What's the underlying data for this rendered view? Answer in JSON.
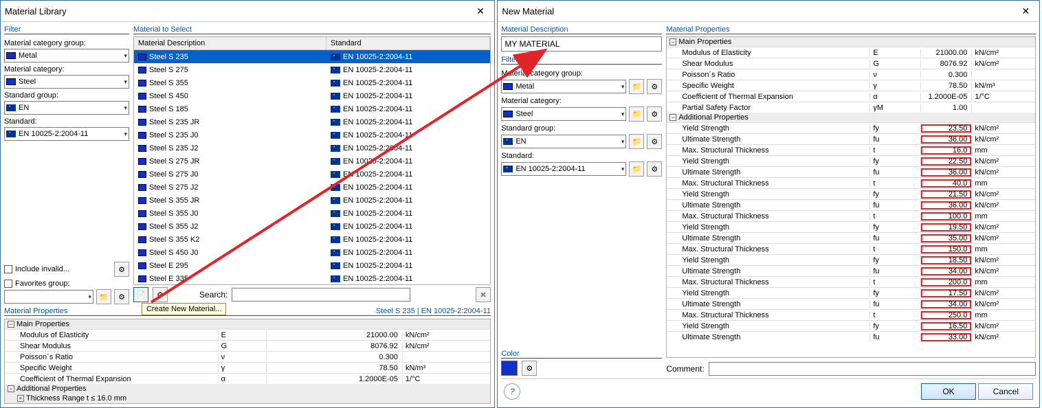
{
  "dlg1": {
    "title": "Material Library",
    "sections": {
      "filter": "Filter",
      "select": "Material to Select",
      "props": "Material Properties"
    },
    "filters": {
      "catgrp_lbl": "Material category group:",
      "catgrp_val": "Metal",
      "cat_lbl": "Material category:",
      "cat_val": "Steel",
      "stdgrp_lbl": "Standard group:",
      "stdgrp_val": "EN",
      "std_lbl": "Standard:",
      "std_val": "EN 10025-2:2004-11",
      "invalid": "Include invalid...",
      "fav": "Favorites group:"
    },
    "listhead": {
      "c1": "Material Description",
      "c2": "Standard"
    },
    "materials": [
      {
        "d": "Steel S 235",
        "s": "EN 10025-2:2004-11",
        "sel": true
      },
      {
        "d": "Steel S 275",
        "s": "EN 10025-2:2004-11"
      },
      {
        "d": "Steel S 355",
        "s": "EN 10025-2:2004-11"
      },
      {
        "d": "Steel S 450",
        "s": "EN 10025-2:2004-11"
      },
      {
        "d": "Steel S 185",
        "s": "EN 10025-2:2004-11"
      },
      {
        "d": "Steel S 235 JR",
        "s": "EN 10025-2:2004-11"
      },
      {
        "d": "Steel S 235 J0",
        "s": "EN 10025-2:2004-11"
      },
      {
        "d": "Steel S 235 J2",
        "s": "EN 10025-2:2004-11"
      },
      {
        "d": "Steel S 275 JR",
        "s": "EN 10025-2:2004-11"
      },
      {
        "d": "Steel S 275 J0",
        "s": "EN 10025-2:2004-11"
      },
      {
        "d": "Steel S 275 J2",
        "s": "EN 10025-2:2004-11"
      },
      {
        "d": "Steel S 355 JR",
        "s": "EN 10025-2:2004-11"
      },
      {
        "d": "Steel S 355 J0",
        "s": "EN 10025-2:2004-11"
      },
      {
        "d": "Steel S 355 J2",
        "s": "EN 10025-2:2004-11"
      },
      {
        "d": "Steel S 355 K2",
        "s": "EN 10025-2:2004-11"
      },
      {
        "d": "Steel S 450 J0",
        "s": "EN 10025-2:2004-11"
      },
      {
        "d": "Steel E 295",
        "s": "EN 10025-2:2004-11"
      },
      {
        "d": "Steel E 335",
        "s": "EN 10025-2:2004-11"
      }
    ],
    "search_lbl": "Search:",
    "tooltip": "Create New Material...",
    "selinfo": "Steel S 235  |  EN 10025-2:2004-11",
    "main_lbl": "Main Properties",
    "addl_lbl": "Additional Properties",
    "thick_lbl": "Thickness Range t ≤ 16.0 mm",
    "props": [
      {
        "n": "Modulus of Elasticity",
        "s": "E",
        "v": "21000.00",
        "u": "kN/cm²"
      },
      {
        "n": "Shear Modulus",
        "s": "G",
        "v": "8076.92",
        "u": "kN/cm²"
      },
      {
        "n": "Poisson´s Ratio",
        "s": "ν",
        "v": "0.300",
        "u": ""
      },
      {
        "n": "Specific Weight",
        "s": "γ",
        "v": "78.50",
        "u": "kN/m³"
      },
      {
        "n": "Coefficient of Thermal Expansion",
        "s": "α",
        "v": "1.2000E-05",
        "u": "1/°C"
      }
    ]
  },
  "dlg2": {
    "title": "New Material",
    "sections": {
      "desc": "Material Description",
      "filter": "Filter",
      "props": "Material Properties",
      "color": "Color"
    },
    "desc_val": "MY MATERIAL",
    "filters": {
      "catgrp_lbl": "Material category group:",
      "catgrp_val": "Metal",
      "cat_lbl": "Material category:",
      "cat_val": "Steel",
      "stdgrp_lbl": "Standard group:",
      "stdgrp_val": "EN",
      "std_lbl": "Standard:",
      "std_val": "EN 10025-2:2004-11"
    },
    "main_lbl": "Main Properties",
    "addl_lbl": "Additional Properties",
    "main": [
      {
        "n": "Modulus of Elasticity",
        "s": "E",
        "v": "21000.00",
        "u": "kN/cm²"
      },
      {
        "n": "Shear Modulus",
        "s": "G",
        "v": "8076.92",
        "u": "kN/cm²"
      },
      {
        "n": "Poisson´s Ratio",
        "s": "ν",
        "v": "0.300",
        "u": ""
      },
      {
        "n": "Specific Weight",
        "s": "γ",
        "v": "78.50",
        "u": "kN/m³"
      },
      {
        "n": "Coefficient of Thermal Expansion",
        "s": "α",
        "v": "1.2000E-05",
        "u": "1/°C"
      },
      {
        "n": "Partial Safety Factor",
        "s": "γM",
        "v": "1.00",
        "u": ""
      }
    ],
    "addl": [
      {
        "n": "Yield Strength",
        "s": "fy",
        "v": "23.50",
        "u": "kN/cm²",
        "hl": true
      },
      {
        "n": "Ultimate Strength",
        "s": "fu",
        "v": "36.00",
        "u": "kN/cm²",
        "hl": true
      },
      {
        "n": "Max. Structural Thickness",
        "s": "t",
        "v": "16.0",
        "u": "mm",
        "hl": true
      },
      {
        "n": "Yield Strength",
        "s": "fy",
        "v": "22.50",
        "u": "kN/cm²",
        "hl": true
      },
      {
        "n": "Ultimate Strength",
        "s": "fu",
        "v": "36.00",
        "u": "kN/cm²",
        "hl": true
      },
      {
        "n": "Max. Structural Thickness",
        "s": "t",
        "v": "40.0",
        "u": "mm",
        "hl": true
      },
      {
        "n": "Yield Strength",
        "s": "fy",
        "v": "21.50",
        "u": "kN/cm²",
        "hl": true
      },
      {
        "n": "Ultimate Strength",
        "s": "fu",
        "v": "36.00",
        "u": "kN/cm²",
        "hl": true
      },
      {
        "n": "Max. Structural Thickness",
        "s": "t",
        "v": "100.0",
        "u": "mm",
        "hl": true
      },
      {
        "n": "Yield Strength",
        "s": "fy",
        "v": "19.50",
        "u": "kN/cm²",
        "hl": true
      },
      {
        "n": "Ultimate Strength",
        "s": "fu",
        "v": "35.00",
        "u": "kN/cm²",
        "hl": true
      },
      {
        "n": "Max. Structural Thickness",
        "s": "t",
        "v": "150.0",
        "u": "mm",
        "hl": true
      },
      {
        "n": "Yield Strength",
        "s": "fy",
        "v": "18.50",
        "u": "kN/cm²",
        "hl": true
      },
      {
        "n": "Ultimate Strength",
        "s": "fu",
        "v": "34.00",
        "u": "kN/cm²",
        "hl": true
      },
      {
        "n": "Max. Structural Thickness",
        "s": "t",
        "v": "200.0",
        "u": "mm",
        "hl": true
      },
      {
        "n": "Yield Strength",
        "s": "fy",
        "v": "17.50",
        "u": "kN/cm²",
        "hl": true
      },
      {
        "n": "Ultimate Strength",
        "s": "fu",
        "v": "34.00",
        "u": "kN/cm²",
        "hl": true
      },
      {
        "n": "Max. Structural Thickness",
        "s": "t",
        "v": "250.0",
        "u": "mm",
        "hl": true
      },
      {
        "n": "Yield Strength",
        "s": "fy",
        "v": "16.50",
        "u": "kN/cm²",
        "hl": true
      },
      {
        "n": "Ultimate Strength",
        "s": "fu",
        "v": "33.00",
        "u": "kN/cm²",
        "hl": true
      }
    ],
    "comment_lbl": "Comment:",
    "ok": "OK",
    "cancel": "Cancel"
  }
}
